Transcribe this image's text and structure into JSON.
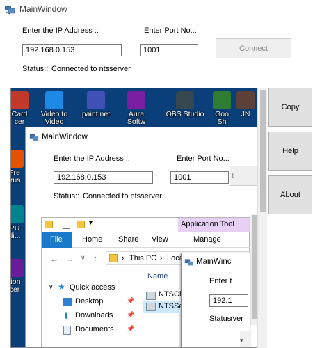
{
  "window": {
    "title": "MainWindow"
  },
  "form": {
    "ip_label": "Enter the IP Address ::",
    "ip_value": "192.168.0.153",
    "port_label": "Enter Port No.::",
    "port_value": "1001",
    "connect_label": "Connect",
    "status_label": "Status::",
    "status_value": "Connected to ntsserver"
  },
  "side_buttons": {
    "copy": "Copy",
    "help": "Help",
    "about": "About"
  },
  "preview": {
    "desktop_icons": [
      {
        "line1": "Card",
        "line2": "cer",
        "color": "#c0392b"
      },
      {
        "line1": "Video to",
        "line2": "Video",
        "color": "#1e88e5"
      },
      {
        "line1": "paint.net",
        "line2": "",
        "color": "#3f51b5"
      },
      {
        "line1": "Aura",
        "line2": "Softw",
        "color": "#7b1fa2"
      },
      {
        "line1": "OBS Studio",
        "line2": "",
        "color": "#37474f"
      },
      {
        "line1": "Goo",
        "line2": "Sh",
        "color": "#2e7d32"
      },
      {
        "line1": "JN",
        "line2": "",
        "color": "#5d4037"
      }
    ],
    "left_icons": [
      {
        "line1": "Fre",
        "line2": "irus",
        "color": "#e65100"
      },
      {
        "line1": "PU",
        "line2": "di...",
        "color": "#00838f"
      },
      {
        "line1": "tion",
        "line2": "cer",
        "color": "#6a1b9a"
      }
    ],
    "inner_window": {
      "title": "MainWindow",
      "ip_label": "Enter the IP Address ::",
      "ip_value": "192.168.0.153",
      "port_label": "Enter Port No.::",
      "port_value": "1001",
      "connect_partial": "t",
      "status_label": "Status::",
      "status_value": "Connected to ntsserver"
    },
    "explorer": {
      "app_tools": "Application Tool",
      "tabs": [
        "File",
        "Home",
        "Share",
        "View",
        "Manage"
      ],
      "path_this_pc": "This PC",
      "path_local": "Local",
      "quick_access": "Quick access",
      "nav_items": [
        "Desktop",
        "Downloads",
        "Documents"
      ],
      "name_header": "Name",
      "files": [
        "NTSCli",
        "NTSSer"
      ]
    },
    "third_window": {
      "title": "MainWinc",
      "ip_label": "Enter t",
      "ip_value": "192.1",
      "status": "Status",
      "status_partial": "rver"
    }
  }
}
